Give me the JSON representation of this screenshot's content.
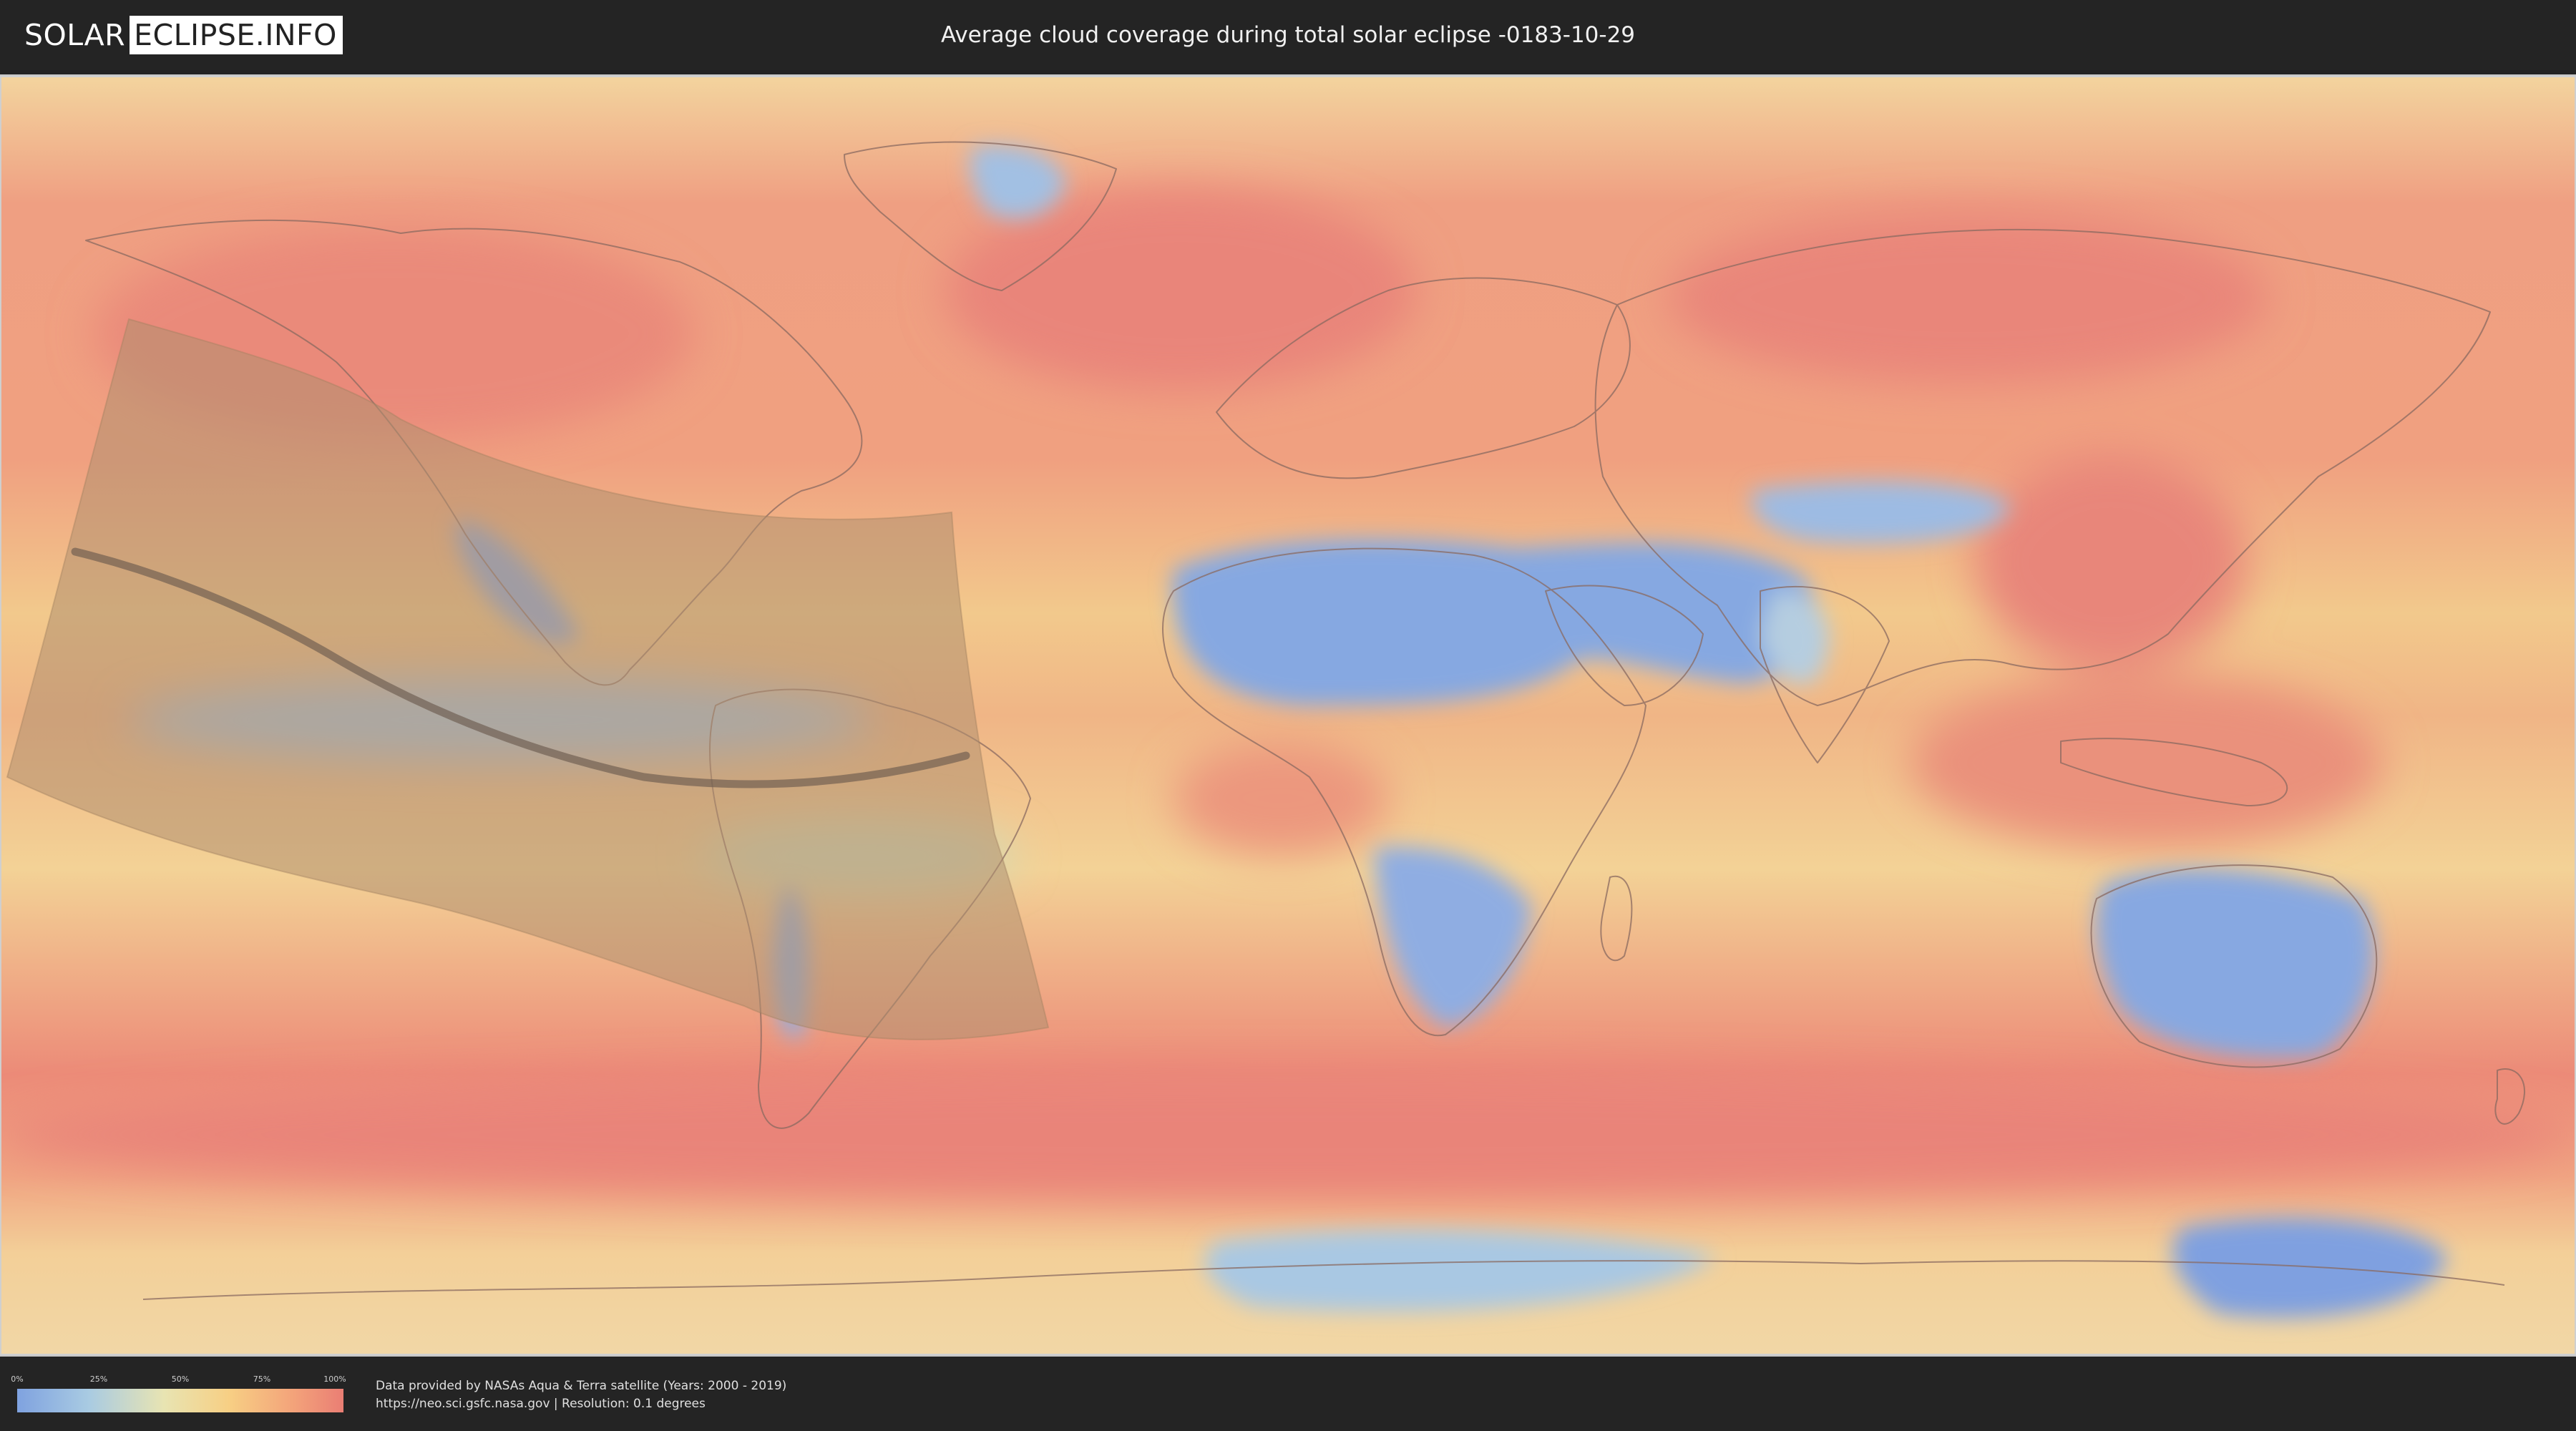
{
  "header": {
    "logo_left": "SOLAR",
    "logo_right": "ECLIPSE.INFO",
    "title": "Average cloud coverage during total solar eclipse -0183-10-29"
  },
  "legend": {
    "ticks": [
      "0%",
      "25%",
      "50%",
      "75%",
      "100%"
    ],
    "colors": [
      "#7fa2e0",
      "#a9cbe2",
      "#e8e4b2",
      "#f7cf84",
      "#f3a27a",
      "#ea7e74"
    ]
  },
  "credits": {
    "line1": "Data provided by NASAs Aqua & Terra satellite (Years: 2000 - 2019)",
    "line2": "https://neo.sci.gsfc.nasa.gov | Resolution: 0.1 degrees"
  },
  "map": {
    "colors": {
      "cloudy": "#ea8a78",
      "medium": "#f2c890",
      "light": "#f3dba8",
      "clear": "#8aa8e2",
      "clear_light": "#a7c3e3",
      "eclipse_shadow": "#b09070",
      "central_line": "#6b5a4e",
      "coastline": "#8a6a60"
    }
  }
}
